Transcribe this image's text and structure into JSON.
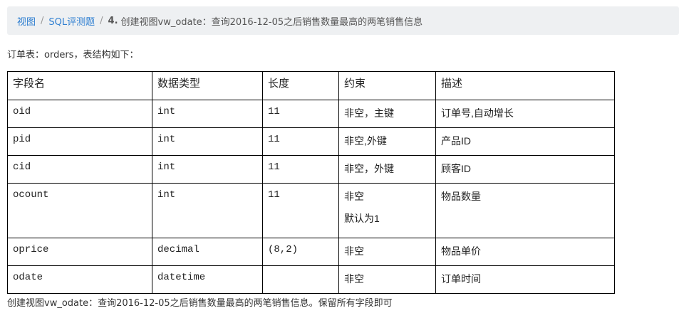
{
  "breadcrumb": {
    "items": [
      "视图",
      "SQL评测题"
    ],
    "separator": "/",
    "current_number": "4.",
    "current_title": "创建视图vw_odate：查询2016-12-05之后销售数量最高的两笔销售信息"
  },
  "intro_text": "订单表：orders，表结构如下：",
  "table": {
    "headers": [
      "字段名",
      "数据类型",
      "长度",
      "约束",
      "描述"
    ],
    "rows": [
      {
        "field": "oid",
        "type": "int",
        "length": "11",
        "constraint": "非空，主键",
        "constraint2": "",
        "desc": "订单号,自动增长"
      },
      {
        "field": "pid",
        "type": "int",
        "length": "11",
        "constraint": "非空,外键",
        "constraint2": "",
        "desc": "产品ID"
      },
      {
        "field": "cid",
        "type": "int",
        "length": "11",
        "constraint": "非空，外键",
        "constraint2": "",
        "desc": "顾客ID"
      },
      {
        "field": "ocount",
        "type": "int",
        "length": "11",
        "constraint": "非空",
        "constraint2": "默认为1",
        "desc": "物品数量"
      },
      {
        "field": "oprice",
        "type": "decimal",
        "length": "(8,2)",
        "constraint": "非空",
        "constraint2": "",
        "desc": "物品单价"
      },
      {
        "field": "odate",
        "type": "datetime",
        "length": "",
        "constraint": "非空",
        "constraint2": "",
        "desc": "订单时间"
      }
    ]
  },
  "footer_text": "创建视图vw_odate：查询2016-12-05之后销售数量最高的两笔销售信息。保留所有字段即可",
  "colors": {
    "link": "#2f7fd1",
    "breadcrumb_bg": "#eef0f2"
  }
}
